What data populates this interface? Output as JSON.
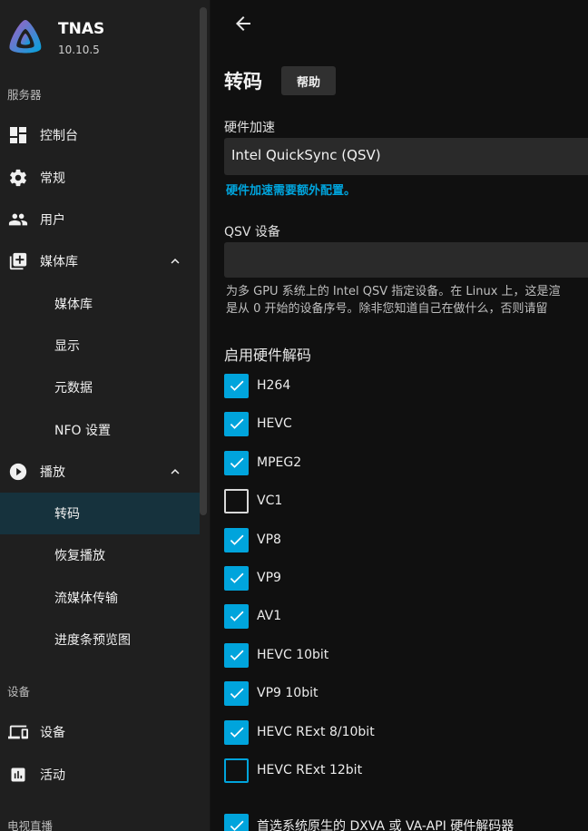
{
  "brand": {
    "name": "TNAS",
    "version": "10.10.5"
  },
  "sidebar": {
    "section_server": "服务器",
    "items": [
      {
        "label": "控制台",
        "icon": "dashboard-icon"
      },
      {
        "label": "常规",
        "icon": "gear-icon"
      },
      {
        "label": "用户",
        "icon": "people-icon"
      },
      {
        "label": "媒体库",
        "icon": "library-add-icon"
      }
    ],
    "library_sub": [
      "媒体库",
      "显示",
      "元数据",
      "NFO 设置"
    ],
    "playback": {
      "label": "播放",
      "icon": "play-circle-icon"
    },
    "playback_sub": [
      "转码",
      "恢复播放",
      "流媒体传输",
      "进度条预览图"
    ],
    "section_devices": "设备",
    "devices": [
      {
        "label": "设备",
        "icon": "devices-icon"
      },
      {
        "label": "活动",
        "icon": "activity-chart-icon"
      }
    ],
    "section_livetv": "电视直播"
  },
  "main": {
    "title": "转码",
    "help_label": "帮助",
    "hw_accel_label": "硬件加速",
    "hw_accel_value": "Intel QuickSync (QSV)",
    "hw_accel_hint": "硬件加速需要额外配置。",
    "qsv_label": "QSV 设备",
    "qsv_value": "",
    "qsv_desc_line1": "为多 GPU 系统上的 Intel QSV 指定设备。在 Linux 上，这是渲",
    "qsv_desc_line2": "是从 0 开始的设备序号。除非您知道自己在做什么，否则请留",
    "decode_title": "启用硬件解码",
    "codecs": [
      {
        "label": "H264",
        "checked": true
      },
      {
        "label": "HEVC",
        "checked": true
      },
      {
        "label": "MPEG2",
        "checked": true
      },
      {
        "label": "VC1",
        "checked": false
      },
      {
        "label": "VP8",
        "checked": true
      },
      {
        "label": "VP9",
        "checked": true
      },
      {
        "label": "AV1",
        "checked": true
      },
      {
        "label": "HEVC 10bit",
        "checked": true
      },
      {
        "label": "VP9 10bit",
        "checked": true
      },
      {
        "label": "HEVC RExt 8/10bit",
        "checked": true
      },
      {
        "label": "HEVC RExt 12bit",
        "checked": false
      }
    ],
    "prefer_native": {
      "label": "首选系统原生的 DXVA 或 VA-API 硬件解码器",
      "checked": true
    }
  },
  "colors": {
    "accent": "#00a4dc",
    "active_bg": "#16323d"
  }
}
